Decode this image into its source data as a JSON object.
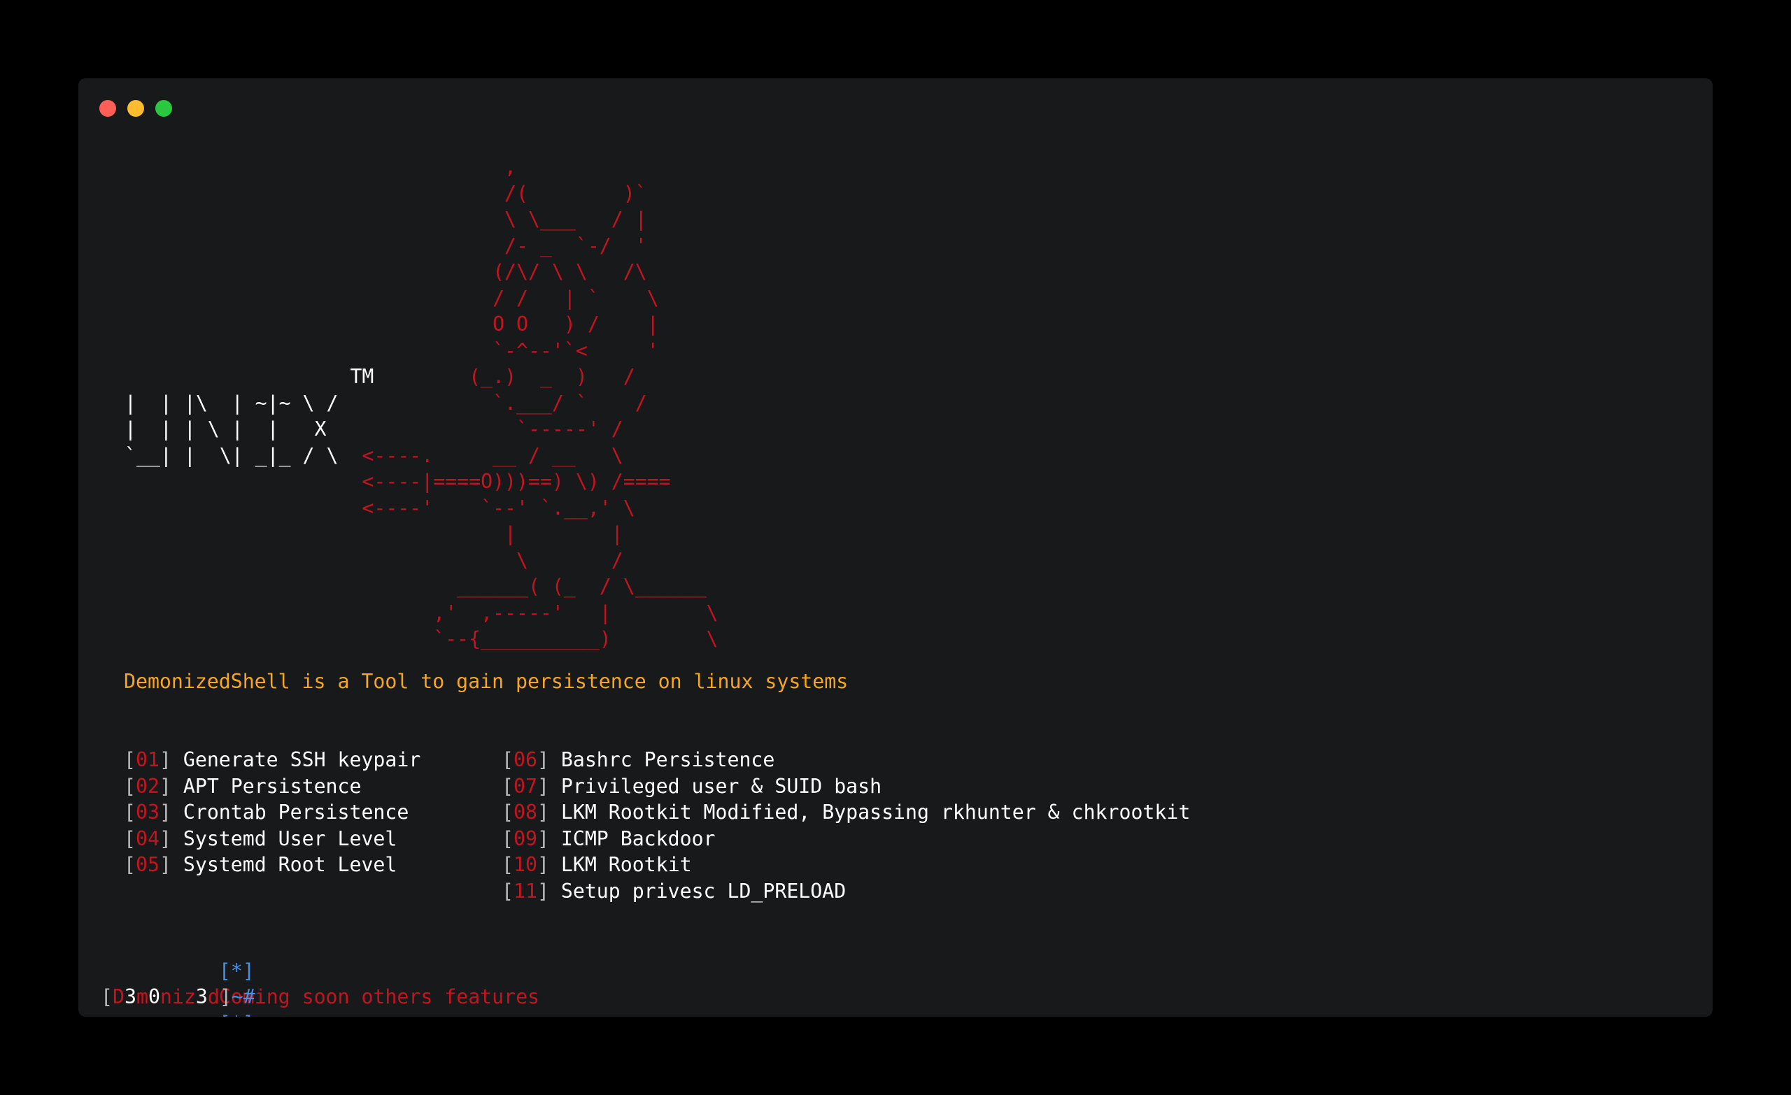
{
  "window": {
    "traffic_lights": [
      {
        "name": "close",
        "color": "#ff5f57"
      },
      {
        "name": "minimize",
        "color": "#febc2e"
      },
      {
        "name": "maximize",
        "color": "#28c840"
      }
    ]
  },
  "banner": {
    "lines": [
      {
        "white": "",
        "red": "                                ,"
      },
      {
        "white": "",
        "red": "                                /(        )`"
      },
      {
        "white": "",
        "red": "                                \\ \\___   / |"
      },
      {
        "white": "",
        "red": "                                /- _  `-/  '"
      },
      {
        "white": "",
        "red": "                               (/\\/ \\ \\   /\\"
      },
      {
        "white": "",
        "red": "                               / /   | `    \\"
      },
      {
        "white": "",
        "red": "                               O O   ) /    |"
      },
      {
        "white": "",
        "red": "                               `-^--'`<     '"
      },
      {
        "white": "                   TM",
        "red": "        (_.)  _  )   /"
      },
      {
        "white": "|  | |\\  | ~|~ \\ /",
        "red": "             `.___/ `    /"
      },
      {
        "white": "|  | | \\ |  |   X",
        "red": "                `-----' /"
      },
      {
        "white": "`__| |  \\| _|_ / \\",
        "red": "  <----.     __ / __   \\"
      },
      {
        "white": "",
        "red": "                    <----|====O)))==) \\) /===="
      },
      {
        "white": "",
        "red": "                    <----'    `--' `.__,' \\"
      },
      {
        "white": "",
        "red": "                                |        |"
      },
      {
        "white": "",
        "red": "                                 \\       /"
      },
      {
        "white": "",
        "red": "                            ______( (_  / \\______"
      },
      {
        "white": "",
        "red": "                          ,'  ,-----'   |        \\"
      },
      {
        "white": "",
        "red": "                          `--{__________)        \\"
      }
    ]
  },
  "tagline": "DemonizedShell is a Tool to gain persistence on linux systems",
  "menu": {
    "column1": [
      {
        "num": "01",
        "label": "Generate SSH keypair"
      },
      {
        "num": "02",
        "label": "APT Persistence"
      },
      {
        "num": "03",
        "label": "Crontab Persistence"
      },
      {
        "num": "04",
        "label": "Systemd User Level"
      },
      {
        "num": "05",
        "label": "Systemd Root Level"
      }
    ],
    "column2": [
      {
        "num": "06",
        "label": "Bashrc Persistence"
      },
      {
        "num": "07",
        "label": "Privileged user & SUID bash"
      },
      {
        "num": "08",
        "label": "LKM Rootkit Modified, Bypassing rkhunter & chkrootkit"
      },
      {
        "num": "09",
        "label": "ICMP Backdoor"
      },
      {
        "num": "10",
        "label": "LKM Rootkit"
      },
      {
        "num": "11",
        "label": "Setup privesc LD_PRELOAD"
      }
    ]
  },
  "notice": {
    "marker": "[*]",
    "text": "Coming soon others features"
  },
  "prompt": {
    "open": "[",
    "parts": [
      {
        "t": "D",
        "c": "#c4141f"
      },
      {
        "t": "3",
        "c": "#ffffff"
      },
      {
        "t": "m",
        "c": "#c4141f"
      },
      {
        "t": "0",
        "c": "#ffffff"
      },
      {
        "t": "niz",
        "c": "#c4141f"
      },
      {
        "t": "3",
        "c": "#ffffff"
      },
      {
        "t": "d",
        "c": "#c4141f"
      }
    ],
    "close": "]",
    "tail": "~#"
  },
  "colors": {
    "red": "#c4141f",
    "white": "#ffffff",
    "orange": "#f5a623",
    "blue": "#4a90e2",
    "grey": "#b8b8b8",
    "background": "#18191b"
  }
}
